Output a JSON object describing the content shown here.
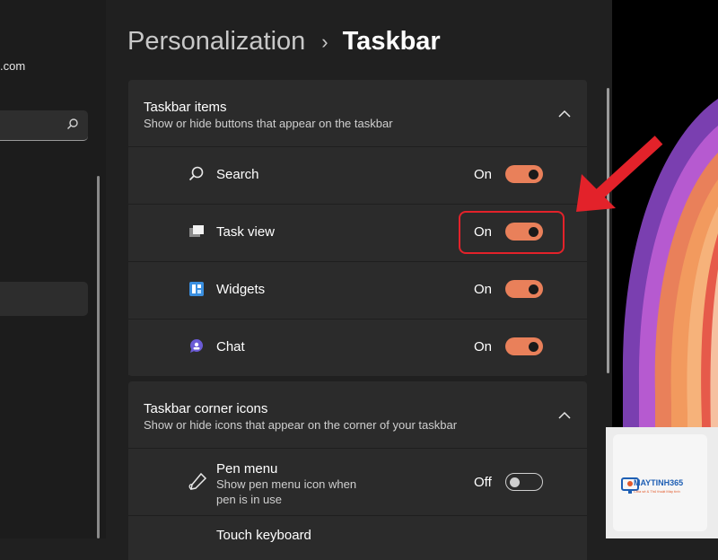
{
  "nav": {
    "account_email": ".com",
    "search_icon": "search-icon"
  },
  "breadcrumb": {
    "parent": "Personalization",
    "separator": "›",
    "current": "Taskbar"
  },
  "taskbar_items": {
    "title": "Taskbar items",
    "subtitle": "Show or hide buttons that appear on the taskbar",
    "items": [
      {
        "label": "Search",
        "state": "On",
        "icon": "search-icon"
      },
      {
        "label": "Task view",
        "state": "On",
        "icon": "task-view-icon"
      },
      {
        "label": "Widgets",
        "state": "On",
        "icon": "widgets-icon"
      },
      {
        "label": "Chat",
        "state": "On",
        "icon": "chat-icon"
      }
    ]
  },
  "corner_icons": {
    "title": "Taskbar corner icons",
    "subtitle": "Show or hide icons that appear on the corner of your taskbar",
    "items": [
      {
        "label": "Pen menu",
        "description": "Show pen menu icon when pen is in use",
        "state": "Off",
        "icon": "pen-icon"
      },
      {
        "label": "Touch keyboard",
        "icon": "keyboard-icon"
      }
    ]
  },
  "watermark": {
    "brand": "MAYTINH365",
    "tagline": "Chia sẻ & Thủ thuật Máy tính"
  },
  "colors": {
    "accent": "#e9805a",
    "highlight": "#e3222a",
    "background": "#202020",
    "card": "#2b2b2b"
  }
}
